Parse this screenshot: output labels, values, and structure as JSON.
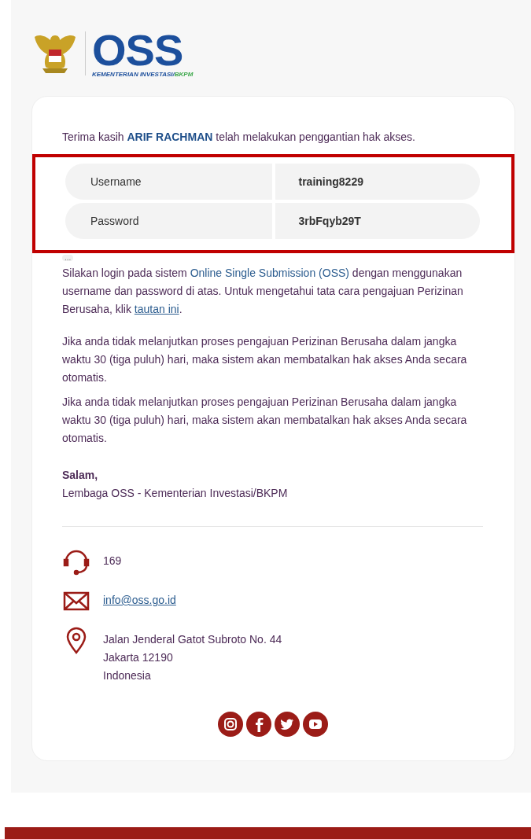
{
  "logo": {
    "wordmark": "OSS",
    "subtitle": "KEMENTERIAN INVESTASI/",
    "subtitle_accent": "BKPM"
  },
  "greeting": {
    "before": "Terima kasih",
    "name": "ARIF RACHMAN",
    "after": "telah melakukan penggantian hak akses."
  },
  "credentials": [
    {
      "label": "Username",
      "value": "training8229"
    },
    {
      "label": "Password",
      "value": "3rbFqyb29T"
    }
  ],
  "highlight": true,
  "trimmed_marker": "...",
  "login_text": {
    "before": "Silakan login pada sistem",
    "system": "Online Single Submission (OSS)",
    "middle": "dengan menggunakan username dan password di atas. Untuk mengetahui tata cara pengajuan Perizinan Berusaha, klik",
    "link": "tautan ini",
    "after": "."
  },
  "notices": [
    "Jika anda tidak melanjutkan proses pengajuan Perizinan Berusaha dalam jangka waktu 30 (tiga puluh) hari, maka sistem akan membatalkan hak akses Anda secara otomatis.",
    "Jika anda tidak melanjutkan proses pengajuan Perizinan Berusaha dalam jangka waktu 30 (tiga puluh) hari, maka sistem akan membatalkan hak akses Anda secara otomatis."
  ],
  "closing": {
    "salutation": "Salam,",
    "sender": "Lembaga OSS - Kementerian Investasi/BKPM"
  },
  "contacts": [
    {
      "kind": "phone",
      "lines": [
        "169"
      ]
    },
    {
      "kind": "email",
      "lines": [
        "info@oss.go.id"
      ]
    },
    {
      "kind": "address",
      "lines": [
        "Jalan Jenderal Gatot Subroto No. 44",
        "Jakarta 12190",
        "Indonesia"
      ]
    }
  ],
  "social": [
    {
      "kind": "instagram"
    },
    {
      "kind": "facebook"
    },
    {
      "kind": "twitter"
    },
    {
      "kind": "youtube"
    }
  ]
}
